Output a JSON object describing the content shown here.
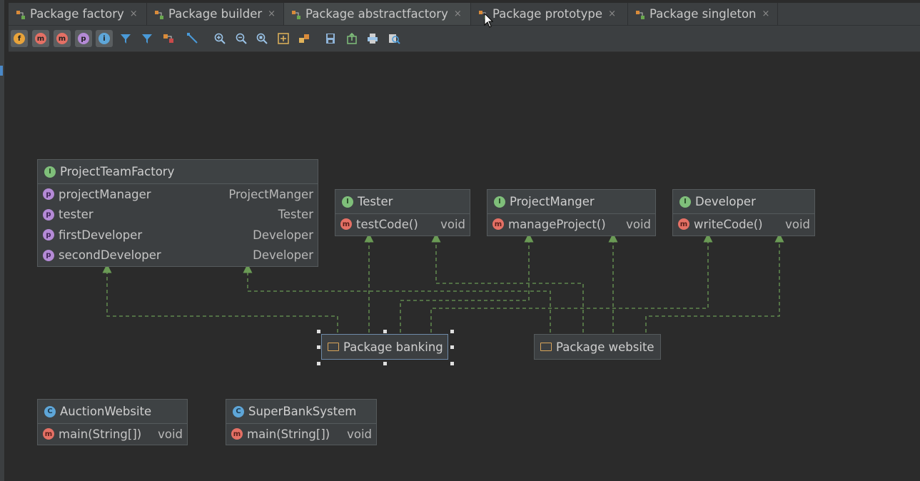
{
  "tabs": [
    {
      "label": "Package factory",
      "active": false
    },
    {
      "label": "Package builder",
      "active": false
    },
    {
      "label": "Package abstractfactory",
      "active": true
    },
    {
      "label": "Package prototype",
      "active": false
    },
    {
      "label": "Package singleton",
      "active": false
    }
  ],
  "tab_close_glyph": "×",
  "toolbar": {
    "fields_badge": "f",
    "constructors_badge": "m",
    "methods_badge": "m",
    "properties_badge": "p",
    "inner_badge": "i"
  },
  "nodes": {
    "project_team_factory": {
      "badge": "I",
      "title": "ProjectTeamFactory",
      "rows": [
        {
          "badge": "p",
          "name": "projectManager",
          "type": "ProjectManger"
        },
        {
          "badge": "p",
          "name": "tester",
          "type": "Tester"
        },
        {
          "badge": "p",
          "name": "firstDeveloper",
          "type": "Developer"
        },
        {
          "badge": "p",
          "name": "secondDeveloper",
          "type": "Developer"
        }
      ]
    },
    "tester": {
      "badge": "I",
      "title": "Tester",
      "rows": [
        {
          "badge": "m",
          "name": "testCode()",
          "type": "void"
        }
      ]
    },
    "project_manger": {
      "badge": "I",
      "title": "ProjectManger",
      "rows": [
        {
          "badge": "m",
          "name": "manageProject()",
          "type": "void"
        }
      ]
    },
    "developer": {
      "badge": "I",
      "title": "Developer",
      "rows": [
        {
          "badge": "m",
          "name": "writeCode()",
          "type": "void"
        }
      ]
    },
    "auction_website": {
      "badge": "C",
      "title": "AuctionWebsite",
      "rows": [
        {
          "badge": "m",
          "name": "main(String[])",
          "type": "void"
        }
      ]
    },
    "super_bank_system": {
      "badge": "C",
      "title": "SuperBankSystem",
      "rows": [
        {
          "badge": "m",
          "name": "main(String[])",
          "type": "void"
        }
      ]
    }
  },
  "packages": {
    "banking": "Package banking",
    "website": "Package website"
  },
  "colors": {
    "background": "#2b2b2b",
    "edge": "#6a9a55",
    "interface_badge": "#7fbf7a",
    "class_badge": "#5ea6d8",
    "property_badge": "#b48ad6",
    "method_badge": "#e47065"
  }
}
